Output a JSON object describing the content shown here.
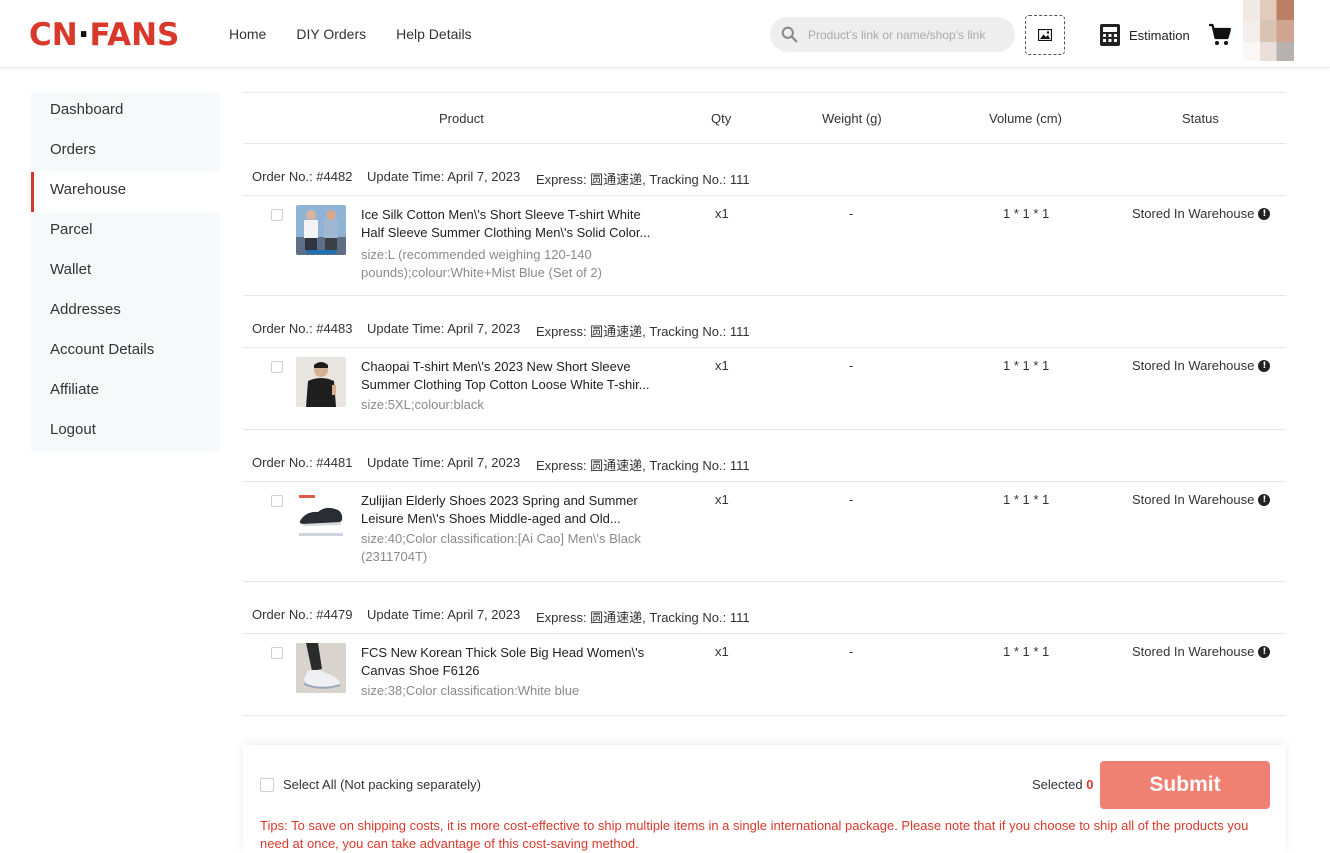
{
  "header": {
    "logo_left": "CN",
    "logo_dot": "·",
    "logo_right": "FANS",
    "nav": [
      "Home",
      "DIY Orders",
      "Help Details"
    ],
    "search_placeholder": "Product's link or name/shop's link",
    "estimation_label": "Estimation"
  },
  "sidebar": {
    "items": [
      "Dashboard",
      "Orders",
      "Warehouse",
      "Parcel",
      "Wallet",
      "Addresses",
      "Account Details",
      "Affiliate",
      "Logout"
    ],
    "active": "Warehouse"
  },
  "table": {
    "columns": [
      "Product",
      "Qty",
      "Weight (g)",
      "Volume (cm)",
      "Status"
    ]
  },
  "orders": [
    {
      "order_no": "Order No.: #4482",
      "update_time": "Update Time: April 7, 2023",
      "express": "Express: 圆通速递, Tracking No.: 111",
      "product": {
        "name": "Ice Silk Cotton Men\\'s Short Sleeve T-shirt White Half Sleeve Summer Clothing Men\\'s Solid Color...",
        "spec": "size:L (recommended weighing 120-140 pounds);colour:White+Mist Blue (Set of 2)",
        "qty": "x1",
        "weight": "-",
        "volume": "1 * 1 * 1",
        "status": "Stored In Warehouse"
      }
    },
    {
      "order_no": "Order No.: #4483",
      "update_time": "Update Time: April 7, 2023",
      "express": "Express: 圆通速递, Tracking No.: 111",
      "product": {
        "name": "Chaopai T-shirt Men\\'s 2023 New Short Sleeve Summer Clothing Top Cotton Loose White T-shir...",
        "spec": "size:5XL;colour:black",
        "qty": "x1",
        "weight": "-",
        "volume": "1 * 1 * 1",
        "status": "Stored In Warehouse"
      }
    },
    {
      "order_no": "Order No.: #4481",
      "update_time": "Update Time: April 7, 2023",
      "express": "Express: 圆通速递, Tracking No.: 111",
      "product": {
        "name": "Zulijian Elderly Shoes 2023 Spring and Summer Leisure Men\\'s Shoes Middle-aged and Old...",
        "spec": "size:40;Color classification:[Ai Cao] Men\\'s Black (2311704T)",
        "qty": "x1",
        "weight": "-",
        "volume": "1 * 1 * 1",
        "status": "Stored In Warehouse"
      }
    },
    {
      "order_no": "Order No.: #4479",
      "update_time": "Update Time: April 7, 2023",
      "express": "Express: 圆通速递, Tracking No.: 111",
      "product": {
        "name": "FCS New Korean Thick Sole Big Head Women\\'s Canvas Shoe F6126",
        "spec": "size:38;Color classification:White blue",
        "qty": "x1",
        "weight": "-",
        "volume": "1 * 1 * 1",
        "status": "Stored In Warehouse"
      }
    }
  ],
  "footer": {
    "select_all": "Select All (Not packing separately)",
    "selected_label": "Selected",
    "selected_count": "0",
    "submit_label": "Submit",
    "tips": "Tips: To save on shipping costs, it is more cost-effective to ship multiple items in a single international package. Please note that if you choose to ship all of the products you need at once, you can take advantage of this cost-saving method."
  },
  "colors": {
    "brand_red": "#d8392b",
    "submit_bg": "#ef8072"
  }
}
